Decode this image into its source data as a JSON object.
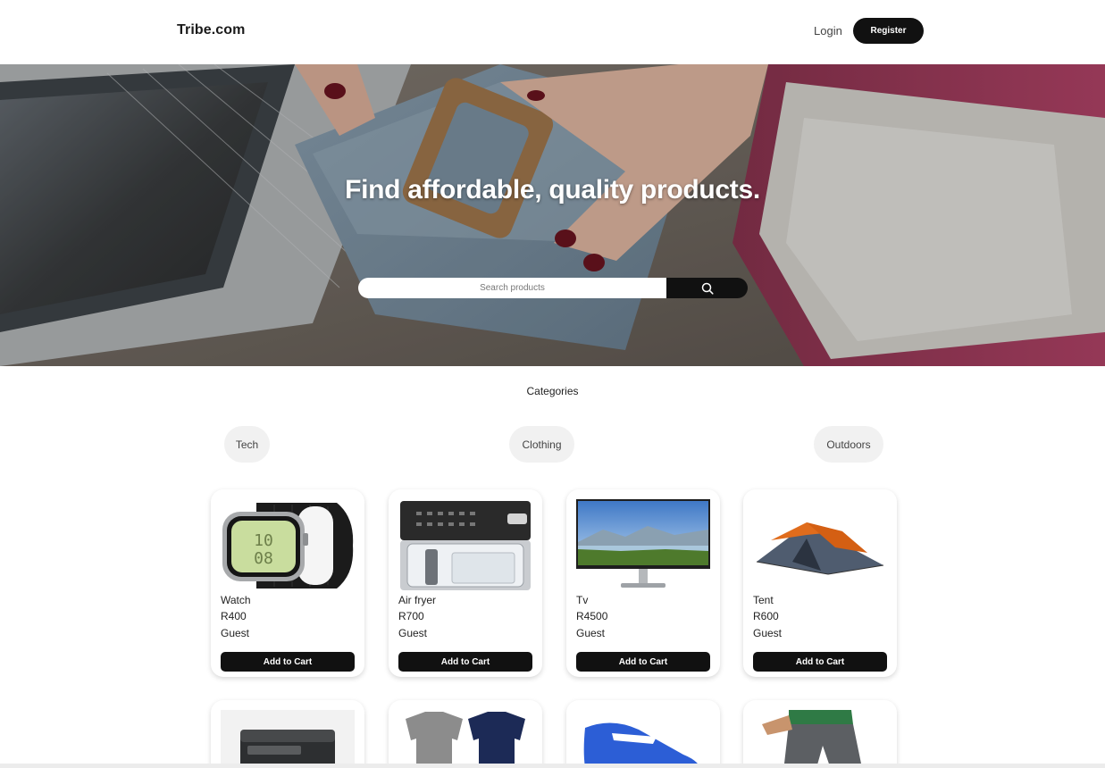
{
  "header": {
    "logo": "Tribe.com",
    "login_label": "Login",
    "register_label": "Register"
  },
  "hero": {
    "title": "Find affordable, quality products.",
    "search_placeholder": "Search products",
    "search_icon": "search-icon"
  },
  "categories": {
    "heading": "Categories",
    "items": [
      "Tech",
      "Clothing",
      "Outdoors"
    ]
  },
  "products": [
    {
      "name": "Watch",
      "price": "R400",
      "seller": "Guest",
      "button": "Add to Cart"
    },
    {
      "name": "Air fryer",
      "price": "R700",
      "seller": "Guest",
      "button": "Add to Cart"
    },
    {
      "name": "Tv",
      "price": "R4500",
      "seller": "Guest",
      "button": "Add to Cart"
    },
    {
      "name": "Tent",
      "price": "R600",
      "seller": "Guest",
      "button": "Add to Cart"
    }
  ],
  "colors": {
    "primary": "#111111",
    "chip_bg": "#f1f1f1",
    "background": "#ffffff"
  }
}
